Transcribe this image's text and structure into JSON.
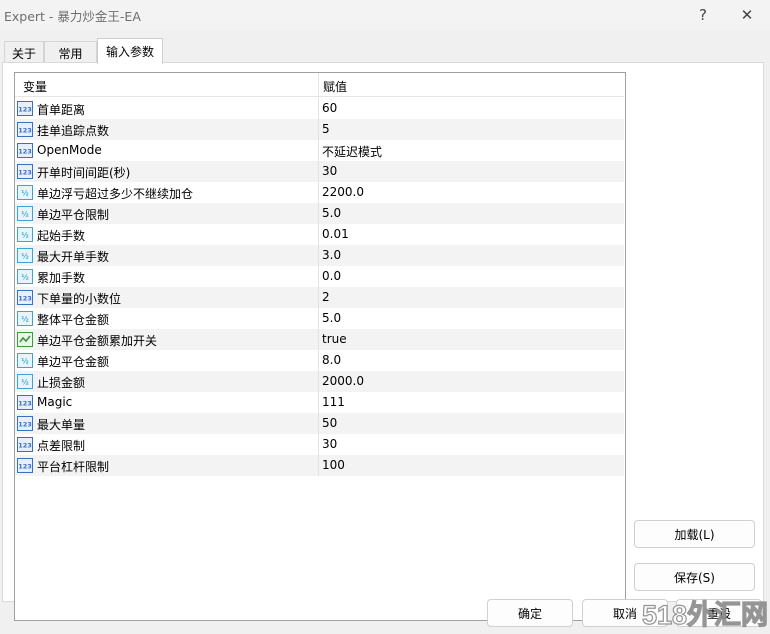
{
  "window": {
    "title": "Expert - 暴力炒金王-EA",
    "help_label": "?",
    "close_label": "✕"
  },
  "tabs": [
    {
      "label": "关于"
    },
    {
      "label": "常用"
    },
    {
      "label": "输入参数"
    }
  ],
  "grid": {
    "header": {
      "name": "变量",
      "value": "赋值"
    },
    "rows": [
      {
        "icon": "int-123-icon",
        "name": "首单距离",
        "value": "60"
      },
      {
        "icon": "int-123-icon",
        "name": "挂单追踪点数",
        "value": "5"
      },
      {
        "icon": "int-123-icon",
        "name": "OpenMode",
        "value": "不延迟模式"
      },
      {
        "icon": "int-123-icon",
        "name": "开单时间间距(秒)",
        "value": "30"
      },
      {
        "icon": "double-icon",
        "name": "单边浮亏超过多少不继续加仓",
        "value": "2200.0"
      },
      {
        "icon": "double-icon",
        "name": "单边平仓限制",
        "value": "5.0"
      },
      {
        "icon": "double-icon",
        "name": "起始手数",
        "value": "0.01"
      },
      {
        "icon": "double-icon",
        "name": "最大开单手数",
        "value": "3.0"
      },
      {
        "icon": "double-icon",
        "name": "累加手数",
        "value": "0.0"
      },
      {
        "icon": "int-123-icon",
        "name": "下单量的小数位",
        "value": "2"
      },
      {
        "icon": "double-icon",
        "name": "整体平仓金额",
        "value": "5.0"
      },
      {
        "icon": "bool-icon",
        "name": "单边平仓金额累加开关",
        "value": "true"
      },
      {
        "icon": "double-icon",
        "name": "单边平仓金额",
        "value": "8.0"
      },
      {
        "icon": "double-icon",
        "name": "止损金额",
        "value": "2000.0"
      },
      {
        "icon": "int-123-icon",
        "name": "Magic",
        "value": "111"
      },
      {
        "icon": "int-123-icon",
        "name": "最大单量",
        "value": "50"
      },
      {
        "icon": "int-123-icon",
        "name": "点差限制",
        "value": "30"
      },
      {
        "icon": "int-123-icon",
        "name": "平台杠杆限制",
        "value": "100"
      }
    ]
  },
  "buttons": {
    "load": "加载(L)",
    "save": "保存(S)",
    "ok": "确定",
    "cancel": "取消",
    "reset": "重设"
  },
  "watermark": {
    "text": "518外汇网"
  },
  "colors": {
    "int_icon": "#3b6fc4",
    "double_icon": "#3aa6d8",
    "bool_icon": "#3a9a3a",
    "watermark": "#8a8a8a"
  }
}
